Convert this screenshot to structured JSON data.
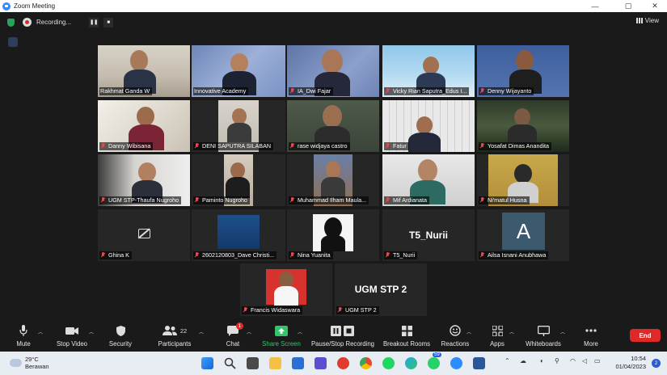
{
  "window": {
    "title": "Zoom Meeting",
    "controls": [
      "—",
      "▢",
      "✕"
    ]
  },
  "topbar": {
    "recording_text": "Recording...",
    "pause_glyph": "❚❚",
    "stop_glyph": "■",
    "view_label": "View"
  },
  "tiles": [
    {
      "name": "Rakhmat Ganda W",
      "muted": false
    },
    {
      "name": "Innovative Academy",
      "muted": false
    },
    {
      "name": "IA_Dwi Fajar",
      "muted": true
    },
    {
      "name": "Vicky Rian Saputra_Edus I...",
      "muted": true
    },
    {
      "name": "Denny Wijayanto",
      "muted": true
    },
    {
      "name": "Danny Wibisana",
      "muted": true
    },
    {
      "name": "DENI SAPUTRA SILABAN",
      "muted": true
    },
    {
      "name": "rase widjaya castro",
      "muted": true
    },
    {
      "name": "Fatur",
      "muted": true
    },
    {
      "name": "Yosafat Dimas Anandita",
      "muted": true
    },
    {
      "name": "UGM STP-Thaufa Nugroho",
      "muted": true
    },
    {
      "name": "Paminto Nugroho",
      "muted": true
    },
    {
      "name": "Muhammad Ilham Maula...",
      "muted": true
    },
    {
      "name": "Mif Ardianata",
      "muted": true
    },
    {
      "name": "Ni'matul Husna",
      "muted": true
    },
    {
      "name": "Ghina K",
      "muted": true
    },
    {
      "name": "2602120803_Dave Christi...",
      "muted": true
    },
    {
      "name": "Nina Yuanita",
      "muted": true
    },
    {
      "name": "T5_Nurii",
      "muted": true
    },
    {
      "name": "Ailsa Isnani Anubhawa",
      "muted": true
    },
    {
      "name": "Francis Widaswara",
      "muted": true
    },
    {
      "name": "UGM STP 2",
      "muted": true
    }
  ],
  "tile_texts": {
    "nurii_display": "T5_Nurii",
    "ailsa_avatar": "A",
    "ugm_display": "UGM STP 2"
  },
  "toolbar": {
    "mute": "Mute",
    "stop_video": "Stop Video",
    "security": "Security",
    "participants": "Participants",
    "participants_count": "22",
    "chat": "Chat",
    "chat_badge": "1",
    "share_screen": "Share Screen",
    "pause_stop_recording": "Pause/Stop Recording",
    "breakout_rooms": "Breakout Rooms",
    "reactions": "Reactions",
    "apps": "Apps",
    "whiteboards": "Whiteboards",
    "more": "More",
    "end": "End"
  },
  "taskbar": {
    "temp": "29°C",
    "weather": "Berawan",
    "whatsapp_badge": "59",
    "time": "10:54",
    "date": "01/04/2023",
    "notifications": "2"
  },
  "colors": {
    "accent_green": "#a5d63f",
    "end_red": "#e02828",
    "share_green": "#35c46a"
  }
}
